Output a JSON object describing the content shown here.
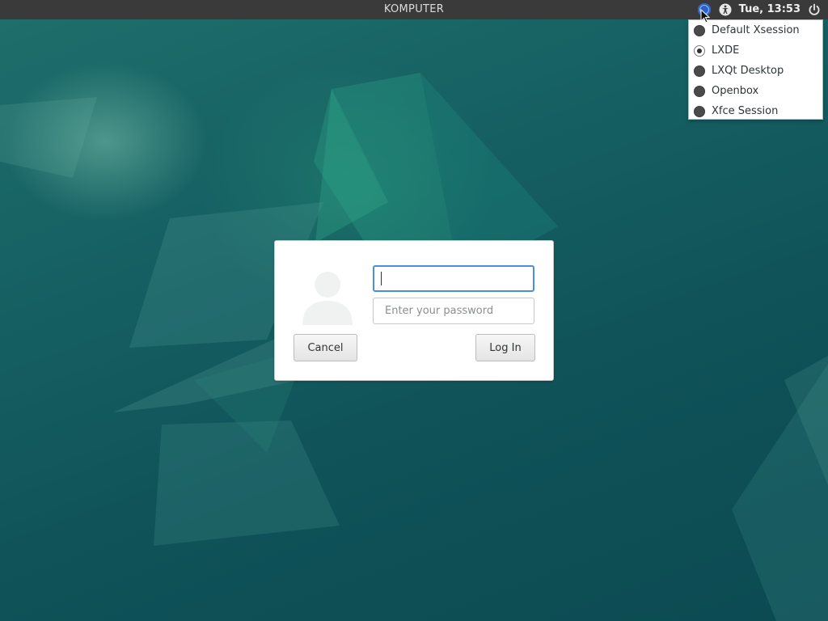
{
  "topbar": {
    "hostname": "KOMPUTER",
    "clock": "Tue, 13:53",
    "icons": [
      "session-icon",
      "accessibility-icon",
      "power-icon"
    ]
  },
  "session_menu": {
    "items": [
      {
        "label": "Default Xsession",
        "selected": false
      },
      {
        "label": "LXDE",
        "selected": true
      },
      {
        "label": "LXQt Desktop",
        "selected": false
      },
      {
        "label": "Openbox",
        "selected": false
      },
      {
        "label": "Xfce Session",
        "selected": false
      }
    ]
  },
  "login": {
    "username_value": "",
    "password_placeholder": "Enter your password",
    "cancel_label": "Cancel",
    "login_label": "Log In",
    "avatar_icon": "user-avatar-icon"
  },
  "colors": {
    "topbar_bg": "#3a3a3a",
    "focus_border": "#4a90d9",
    "wallpaper_main": "#155f62",
    "session_icon": "#2a62c9"
  }
}
